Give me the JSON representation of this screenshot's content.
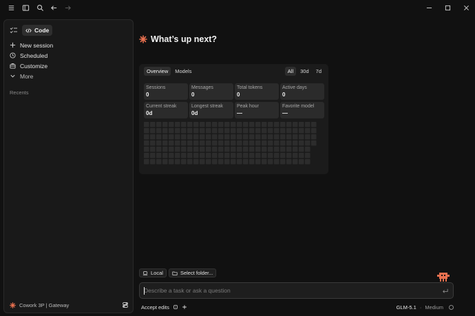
{
  "titlebar": {
    "icons": [
      "menu-icon",
      "sidebar-toggle-icon",
      "search-icon",
      "back-arrow-icon",
      "forward-arrow-icon"
    ],
    "window_controls": [
      "minimize",
      "maximize",
      "close"
    ]
  },
  "sidebar": {
    "mode_label": "Code",
    "nav": [
      {
        "label": "New session",
        "icon": "plus-icon"
      },
      {
        "label": "Scheduled",
        "icon": "clock-icon"
      },
      {
        "label": "Customize",
        "icon": "briefcase-icon"
      },
      {
        "label": "More",
        "icon": "chevron-down-icon"
      }
    ],
    "recents_label": "Recents",
    "footer_label": "Cowork 3P | Gateway"
  },
  "main": {
    "headline": "What’s up next?",
    "accent_color": "#e8704f"
  },
  "stats": {
    "tabs": [
      "Overview",
      "Models"
    ],
    "ranges": [
      "All",
      "30d",
      "7d"
    ],
    "cards": [
      {
        "label": "Sessions",
        "value": "0"
      },
      {
        "label": "Messages",
        "value": "0"
      },
      {
        "label": "Total tokens",
        "value": "0"
      },
      {
        "label": "Active days",
        "value": "0"
      },
      {
        "label": "Current streak",
        "value": "0d"
      },
      {
        "label": "Longest streak",
        "value": "0d"
      },
      {
        "label": "Peak hour",
        "value": "—"
      },
      {
        "label": "Favorite model",
        "value": "—"
      }
    ],
    "heatmap_color": "#2c2c2c"
  },
  "composer": {
    "location_chip": "Local",
    "folder_chip": "Select folder...",
    "placeholder": "Describe a task or ask a question",
    "mode_label": "Accept edits",
    "model_name": "GLM-5.1",
    "model_sep": "·",
    "model_effort": "Medium"
  }
}
